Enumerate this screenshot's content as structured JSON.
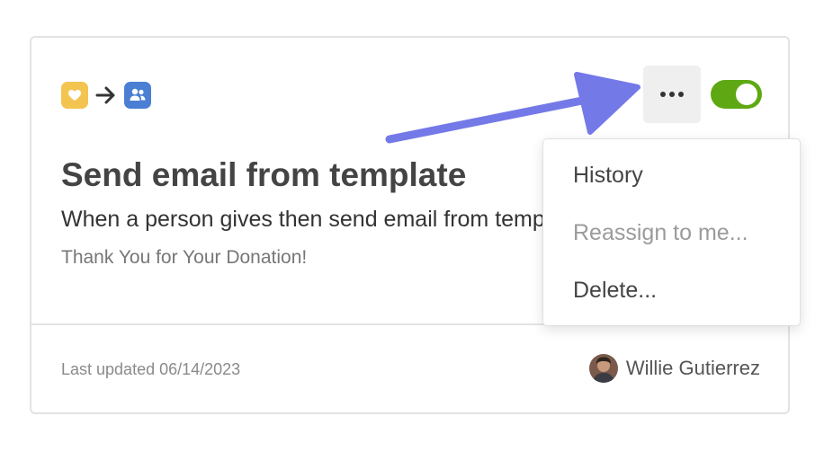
{
  "card": {
    "title": "Send email from template",
    "description": "When a person gives then send email from template",
    "template_name": "Thank You for Your Donation!",
    "last_updated": "Last updated 06/14/2023",
    "owner_name": "Willie Gutierrez",
    "enabled": true
  },
  "flow": {
    "trigger_icon": "heart-icon",
    "action_icon": "people-icon",
    "connector_icon": "right-arrow-icon"
  },
  "menu": {
    "items": [
      {
        "label": "History",
        "disabled": false
      },
      {
        "label": "Reassign to me...",
        "disabled": true
      },
      {
        "label": "Delete...",
        "disabled": false
      }
    ]
  },
  "colors": {
    "giving": "#f3c550",
    "people": "#4a7fd4",
    "toggle_on": "#5ea913",
    "pointer": "#7479e8"
  }
}
